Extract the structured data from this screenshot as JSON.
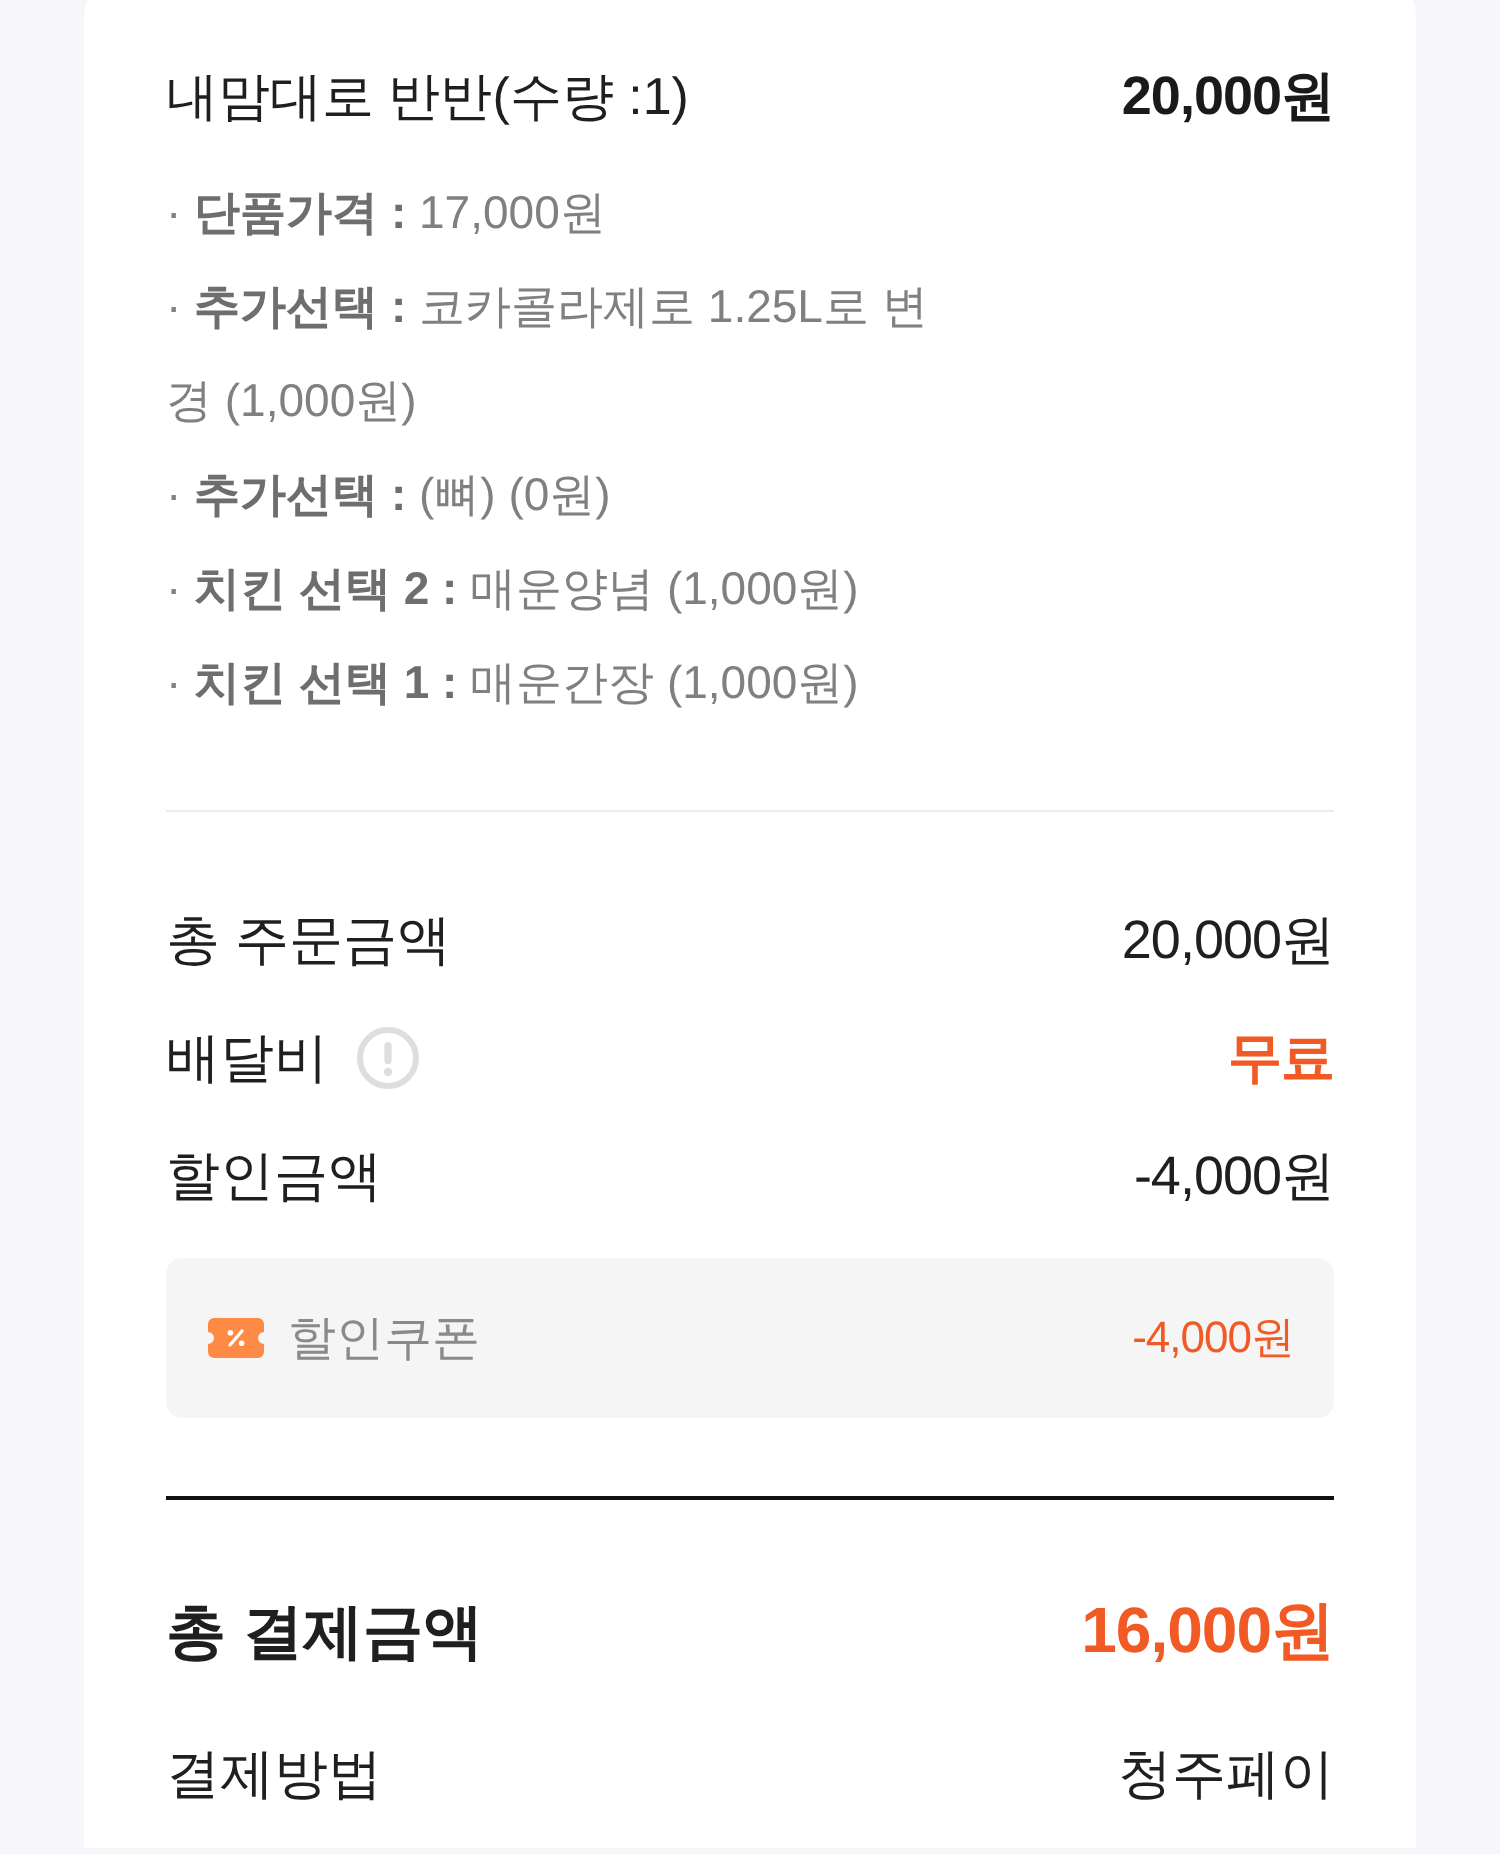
{
  "order_item": {
    "name": "내맘대로 반반(수량 :1)",
    "price": "20,000원",
    "options": [
      "· **단품가격 :** 17,000원",
      "· **추가선택 :** 코카콜라제로 1.25L로 변경 (1,000원)",
      "· **추가선택 :** (뼈) (0원)",
      "· **치킨 선택 2 :** 매운양념 (1,000원)",
      "· **치킨 선택 1 :** 매운간장 (1,000원)"
    ]
  },
  "summary": [
    {
      "label": "총 주문금액",
      "value": "20,000원",
      "info": false,
      "accent": false
    },
    {
      "label": "배달비",
      "value": "무료",
      "info": true,
      "accent": true
    },
    {
      "label": "할인금액",
      "value": "-4,000원",
      "info": false,
      "accent": false
    }
  ],
  "discounts": [
    {
      "label": "할인쿠폰",
      "value": "-4,000원"
    }
  ],
  "total": {
    "label": "총 결제금액",
    "value": "16,000원"
  },
  "payment": {
    "label": "결제방법",
    "value": "청주페이"
  }
}
